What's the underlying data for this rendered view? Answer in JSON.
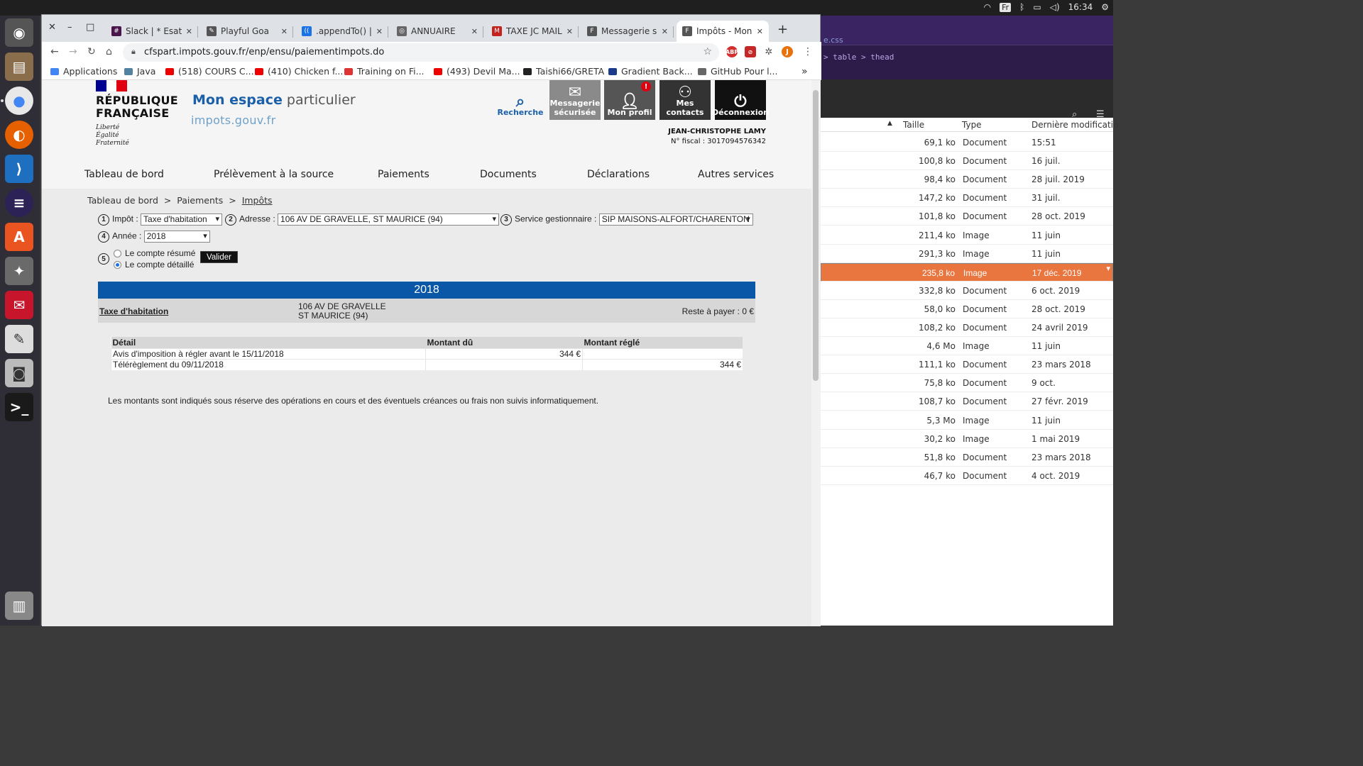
{
  "system": {
    "kbd_layout": "Fr",
    "clock": "16:34"
  },
  "dock": [
    "chromium-icon",
    "files-icon",
    "chrome-icon",
    "firefox-icon",
    "vscode-icon",
    "eclipse-icon",
    "software-center-icon",
    "settings-icon",
    "mail-icon",
    "text-editor-icon",
    "camera-icon",
    "terminal-icon",
    "trash-icon"
  ],
  "filemanager": {
    "editor_tab": "e.css",
    "editor_crumb": [
      "table",
      "thead"
    ],
    "columns": [
      "Taille",
      "Type",
      "Dernière modificatio"
    ],
    "rows": [
      {
        "size": "69,1 ko",
        "type": "Document",
        "date": "15:51"
      },
      {
        "size": "100,8 ko",
        "type": "Document",
        "date": "16 juil."
      },
      {
        "size": "98,4 ko",
        "type": "Document",
        "date": "28 juil. 2019"
      },
      {
        "size": "147,2 ko",
        "type": "Document",
        "date": "31 juil."
      },
      {
        "size": "101,8 ko",
        "type": "Document",
        "date": "28 oct. 2019"
      },
      {
        "size": "211,4 ko",
        "type": "Image",
        "date": "11 juin"
      },
      {
        "size": "291,3 ko",
        "type": "Image",
        "date": "11 juin"
      },
      {
        "size": "235,8 ko",
        "type": "Image",
        "date": "17 déc. 2019"
      },
      {
        "size": "332,8 ko",
        "type": "Document",
        "date": "6 oct. 2019"
      },
      {
        "size": "58,0 ko",
        "type": "Document",
        "date": "28 oct. 2019"
      },
      {
        "size": "108,2 ko",
        "type": "Document",
        "date": "24 avril 2019"
      },
      {
        "size": "4,6 Mo",
        "type": "Image",
        "date": "11 juin"
      },
      {
        "size": "111,1 ko",
        "type": "Document",
        "date": "23 mars 2018"
      },
      {
        "size": "75,8 ko",
        "type": "Document",
        "date": "9 oct."
      },
      {
        "size": "108,7 ko",
        "type": "Document",
        "date": "27 févr. 2019"
      },
      {
        "size": "5,3 Mo",
        "type": "Image",
        "date": "11 juin"
      },
      {
        "size": "30,2 ko",
        "type": "Image",
        "date": "1 mai 2019"
      },
      {
        "size": "51,8 ko",
        "type": "Document",
        "date": "23 mars 2018"
      },
      {
        "size": "46,7 ko",
        "type": "Document",
        "date": "4 oct. 2019"
      }
    ],
    "selected_index": 7
  },
  "browser": {
    "tabs": [
      {
        "title": "Slack | * Esat | I",
        "color": "#4a154b",
        "glyph": "#"
      },
      {
        "title": "Playful Goa",
        "color": "#555",
        "glyph": "✎"
      },
      {
        "title": ".appendTo() | j",
        "color": "#1a73e8",
        "glyph": "(("
      },
      {
        "title": "ANNUAIRE",
        "color": "#666",
        "glyph": "◎"
      },
      {
        "title": "TAXE JC MAIL",
        "color": "#c5221f",
        "glyph": "M"
      },
      {
        "title": "Messagerie sé",
        "color": "#555",
        "glyph": "F"
      },
      {
        "title": "Impôts - Mon e",
        "color": "#555",
        "glyph": "F"
      }
    ],
    "active_tab": 6,
    "url": "cfspart.impots.gouv.fr/enp/ensu/paiementimpots.do",
    "bookmarks": [
      {
        "label": "Applications",
        "color": "#4285f4"
      },
      {
        "label": "Java",
        "color": "#5382a1"
      },
      {
        "label": "(518) COURS C...",
        "color": "#e00"
      },
      {
        "label": "(410) Chicken f...",
        "color": "#e00"
      },
      {
        "label": "Training on Fi...",
        "color": "#d33"
      },
      {
        "label": "(493) Devil Ma...",
        "color": "#e00"
      },
      {
        "label": "Taishi66/GRETA",
        "color": "#222"
      },
      {
        "label": "Gradient Back...",
        "color": "#1a3a8a"
      },
      {
        "label": "GitHub Pour l...",
        "color": "#666"
      }
    ],
    "bookmarks_more": "»"
  },
  "site": {
    "rf_line1": "RÉPUBLIQUE",
    "rf_line2": "FRANÇAISE",
    "devise": [
      "Liberté",
      "Égalité",
      "Fraternité"
    ],
    "espace_a": "Mon espace",
    "espace_b": " particulier",
    "impots": "impots.gouv.fr",
    "header_buttons": [
      {
        "label": "Recherche",
        "icon": "search-icon",
        "bg": "#f5f5f5",
        "fg": "#1b5fa8"
      },
      {
        "label": "Messagerie sécurisée",
        "icon": "mail-icon",
        "bg": "#8a8a8a",
        "fg": "#fff"
      },
      {
        "label": "Mon profil",
        "icon": "user-icon",
        "bg": "#555",
        "fg": "#fff"
      },
      {
        "label": "Mes contacts",
        "icon": "contacts-icon",
        "bg": "#333",
        "fg": "#fff"
      },
      {
        "label": "Déconnexion",
        "icon": "power-icon",
        "bg": "#111",
        "fg": "#fff"
      }
    ],
    "profile_badge": "!",
    "user_name": "JEAN-CHRISTOPHE LAMY",
    "fiscal": "N° fiscal : 3017094576342",
    "nav": [
      "Tableau de bord",
      "Prélèvement à la source",
      "Paiements",
      "Documents",
      "Déclarations",
      "Autres services"
    ],
    "breadcrumb": [
      "Tableau de bord",
      "Paiements",
      "Impôts"
    ],
    "form": {
      "impot_label": "Impôt :",
      "impot_value": "Taxe d'habitation",
      "adresse_label": "Adresse :",
      "adresse_value": "106 AV DE GRAVELLE, ST MAURICE (94)",
      "service_label": "Service gestionnaire :",
      "service_value": "SIP MAISONS-ALFORT/CHARENTON",
      "annee_label": "Année :",
      "annee_value": "2018",
      "radio1": "Le compte résumé",
      "radio2": "Le compte détaillé",
      "valider": "Valider"
    },
    "year": "2018",
    "tax_name": "Taxe d'habitation",
    "tax_addr1": "106 AV DE GRAVELLE",
    "tax_addr2": "ST MAURICE (94)",
    "reste": "Reste à payer : 0 €",
    "table": {
      "headers": [
        "Détail",
        "Montant dû",
        "Montant réglé"
      ],
      "rows": [
        [
          "Avis d'imposition à régler avant le 15/11/2018",
          "344 €",
          ""
        ],
        [
          "Télérèglement du 09/11/2018",
          "",
          "344 €"
        ]
      ]
    },
    "note": "Les montants sont indiqués sous réserve des opérations en cours et des éventuels créances ou frais non suivis informatiquement."
  }
}
